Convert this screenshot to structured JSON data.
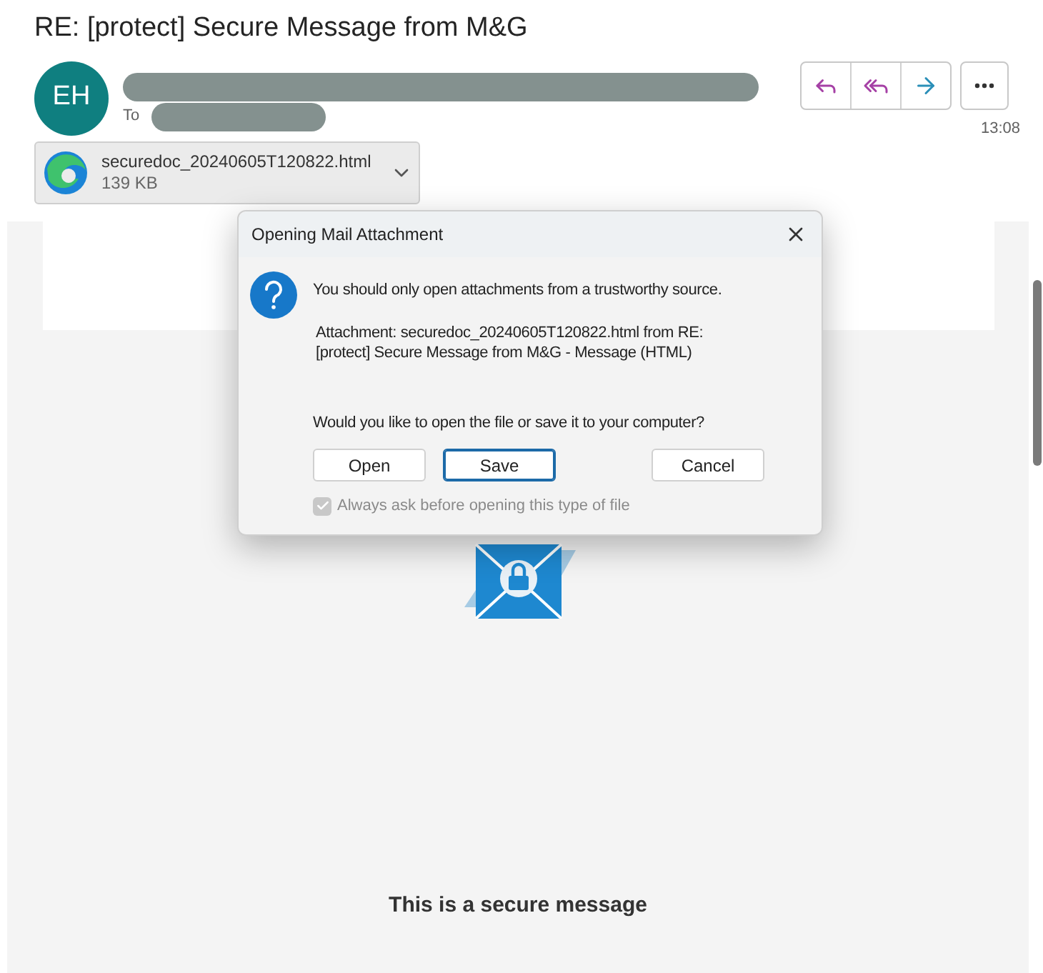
{
  "message": {
    "subject": "RE: [protect] Secure Message from M&G",
    "avatar_initials": "EH",
    "to_label": "To",
    "time": "13:08"
  },
  "attachment": {
    "name": "securedoc_20240605T120822.html",
    "size": "139 KB"
  },
  "body": {
    "text": "This is a secure message"
  },
  "dialog": {
    "title": "Opening Mail Attachment",
    "warning": "You should only open attachments from a trustworthy source.",
    "details": "Attachment: securedoc_20240605T120822.html from RE: [protect] Secure Message from M&G - Message (HTML)",
    "question": "Would you like to open the file or save it to your computer?",
    "buttons": [
      {
        "label": "Open",
        "selected": false
      },
      {
        "label": "Save",
        "selected": true
      },
      {
        "label": "Cancel",
        "selected": false
      }
    ],
    "checkbox": {
      "label": "Always ask before opening this type of file",
      "checked": true,
      "disabled": true
    }
  }
}
